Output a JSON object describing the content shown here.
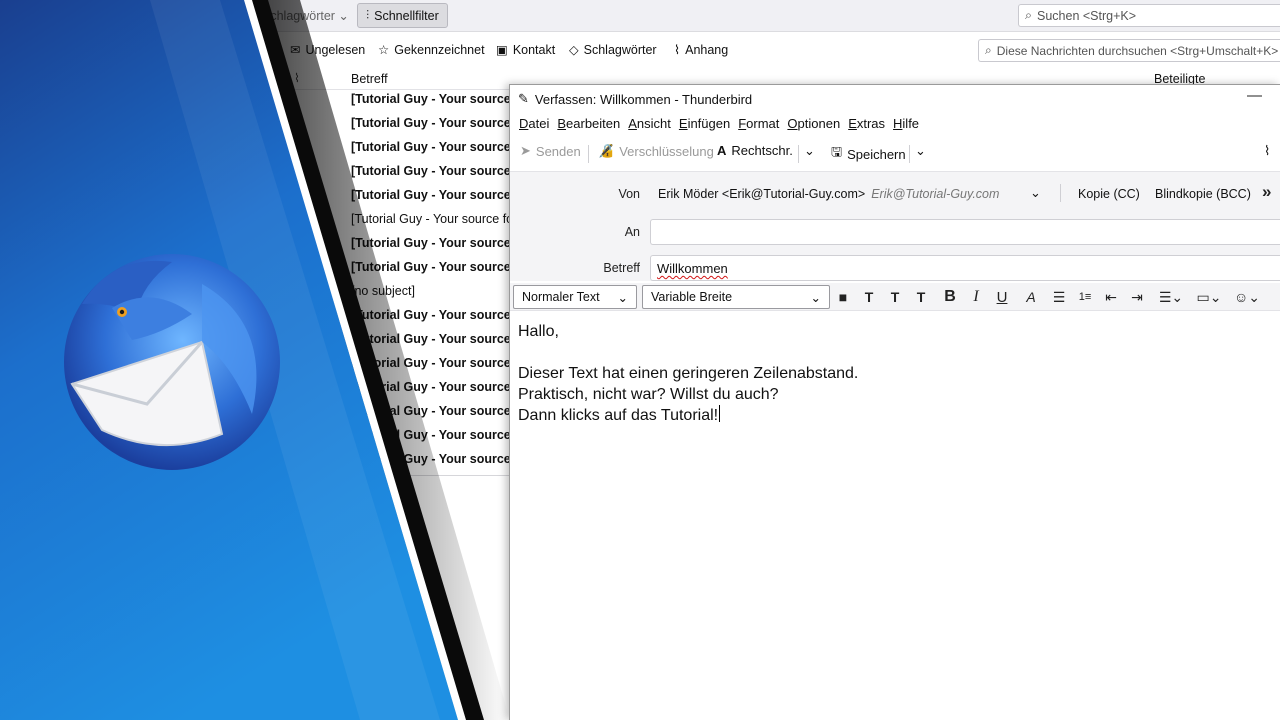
{
  "background_window": {
    "topbar": {
      "tags_dropdown": "Schlagwörter",
      "quickfilter_label": "Schnellfilter",
      "global_search_placeholder": "Suchen <Strg+K>"
    },
    "filterbar": {
      "unread": "Ungelesen",
      "starred": "Gekennzeichnet",
      "contact": "Kontakt",
      "tags": "Schlagwörter",
      "attachment": "Anhang",
      "search_placeholder": "Diese Nachrichten durchsuchen <Strg+Umschalt+K>"
    },
    "columns": {
      "subject": "Betreff",
      "participants": "Beteiligte"
    },
    "messages": [
      {
        "subject": "[Tutorial Guy - Your source fo",
        "bold": true
      },
      {
        "subject": "[Tutorial Guy - Your source fo",
        "bold": true
      },
      {
        "subject": "[Tutorial Guy - Your source fo",
        "bold": true
      },
      {
        "subject": "[Tutorial Guy - Your source fo",
        "bold": true
      },
      {
        "subject": "[Tutorial Guy - Your source fo",
        "bold": true
      },
      {
        "subject": "[Tutorial Guy - Your source for",
        "bold": false
      },
      {
        "subject": "[Tutorial Guy - Your source fo",
        "bold": true
      },
      {
        "subject": "[Tutorial Guy - Your source fo",
        "bold": true
      },
      {
        "subject": "[no subject]",
        "bold": false
      },
      {
        "subject": "[Tutorial Guy - Your source fo",
        "bold": true
      },
      {
        "subject": "[Tutorial Guy - Your source fo",
        "bold": true
      },
      {
        "subject": "[Tutorial Guy - Your source fo",
        "bold": true
      },
      {
        "subject": "[Tutorial Guy - Your source fo",
        "bold": true
      },
      {
        "subject": "[Tutorial Guy - Your source fo",
        "bold": true
      },
      {
        "subject": "[Tutorial Guy - Your source fo",
        "bold": true
      },
      {
        "subject": "[Tutorial Guy - Your source fo",
        "bold": true
      }
    ]
  },
  "compose": {
    "title": "Verfassen: Willkommen - Thunderbird",
    "menu": [
      "Datei",
      "Bearbeiten",
      "Ansicht",
      "Einfügen",
      "Format",
      "Optionen",
      "Extras",
      "Hilfe"
    ],
    "toolbar": {
      "send": "Senden",
      "encryption": "Verschlüsselung",
      "spellcheck": "Rechtschr.",
      "save": "Speichern"
    },
    "headers": {
      "from_label": "Von",
      "from_value": "Erik Möder <Erik@Tutorial-Guy.com>",
      "from_identity": "Erik@Tutorial-Guy.com",
      "cc": "Kopie (CC)",
      "bcc": "Blindkopie (BCC)",
      "to_label": "An",
      "to_value": "",
      "subject_label": "Betreff",
      "subject_value": "Willkommen"
    },
    "format": {
      "paragraph_style": "Normaler Text",
      "font": "Variable Breite"
    },
    "body_lines": [
      "Hallo,",
      "",
      "Dieser Text hat einen geringeren Zeilenabstand.",
      "Praktisch, nicht war? Willst du auch?",
      "Dann klicks auf das Tutorial!"
    ]
  },
  "colors": {
    "overlay_blue_dark": "#1b4fa3",
    "overlay_blue_light": "#1f8fe0",
    "spellcheck_underline": "#d21515"
  }
}
